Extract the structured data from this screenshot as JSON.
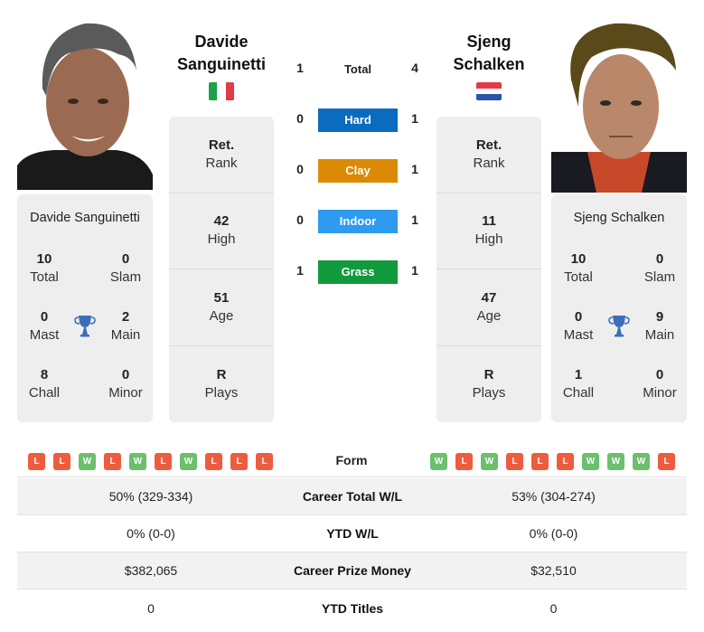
{
  "players": [
    {
      "name": "Davide Sanguinetti",
      "name_line1": "Davide",
      "name_line2": "Sanguinetti",
      "country": "Italy",
      "flag_colors": [
        "#1aa34a",
        "#ffffff",
        "#e23a4a"
      ],
      "info": [
        {
          "value": "Ret.",
          "label": "Rank"
        },
        {
          "value": "42",
          "label": "High"
        },
        {
          "value": "51",
          "label": "Age"
        },
        {
          "value": "R",
          "label": "Plays"
        }
      ],
      "titles": {
        "total": "10",
        "total_label": "Total",
        "slam": "0",
        "slam_label": "Slam",
        "mast": "0",
        "mast_label": "Mast",
        "main": "2",
        "main_label": "Main",
        "chall": "8",
        "chall_label": "Chall",
        "minor": "0",
        "minor_label": "Minor"
      },
      "form": [
        "L",
        "L",
        "W",
        "L",
        "W",
        "L",
        "W",
        "L",
        "L",
        "L"
      ]
    },
    {
      "name": "Sjeng Schalken",
      "name_line1": "Sjeng",
      "name_line2": "Schalken",
      "country": "Netherlands",
      "flag_colors": [
        "#e23a4a",
        "#ffffff",
        "#2a55a8"
      ],
      "info": [
        {
          "value": "Ret.",
          "label": "Rank"
        },
        {
          "value": "11",
          "label": "High"
        },
        {
          "value": "47",
          "label": "Age"
        },
        {
          "value": "R",
          "label": "Plays"
        }
      ],
      "titles": {
        "total": "10",
        "total_label": "Total",
        "slam": "0",
        "slam_label": "Slam",
        "mast": "0",
        "mast_label": "Mast",
        "main": "9",
        "main_label": "Main",
        "chall": "1",
        "chall_label": "Chall",
        "minor": "0",
        "minor_label": "Minor"
      },
      "form": [
        "W",
        "L",
        "W",
        "L",
        "L",
        "L",
        "W",
        "W",
        "W",
        "L"
      ]
    }
  ],
  "h2h": {
    "total": {
      "label": "Total",
      "left": "1",
      "right": "4"
    },
    "surfaces": [
      {
        "label": "Hard",
        "left": "0",
        "right": "1",
        "color": "#0b6bbf"
      },
      {
        "label": "Clay",
        "left": "0",
        "right": "1",
        "color": "#dc8a06"
      },
      {
        "label": "Indoor",
        "left": "0",
        "right": "1",
        "color": "#2e9bf0"
      },
      {
        "label": "Grass",
        "left": "1",
        "right": "1",
        "color": "#109a3c"
      }
    ]
  },
  "form_label": "Form",
  "stats": [
    {
      "label": "Career Total W/L",
      "left": "50% (329-334)",
      "right": "53% (304-274)"
    },
    {
      "label": "YTD W/L",
      "left": "0% (0-0)",
      "right": "0% (0-0)"
    },
    {
      "label": "Career Prize Money",
      "left": "$382,065",
      "right": "$32,510"
    },
    {
      "label": "YTD Titles",
      "left": "0",
      "right": "0"
    }
  ],
  "colors": {
    "win": "#6cbf6c",
    "loss": "#ee5c40",
    "trophy": "#3a6fb8",
    "card_bg": "#eeeeee"
  }
}
